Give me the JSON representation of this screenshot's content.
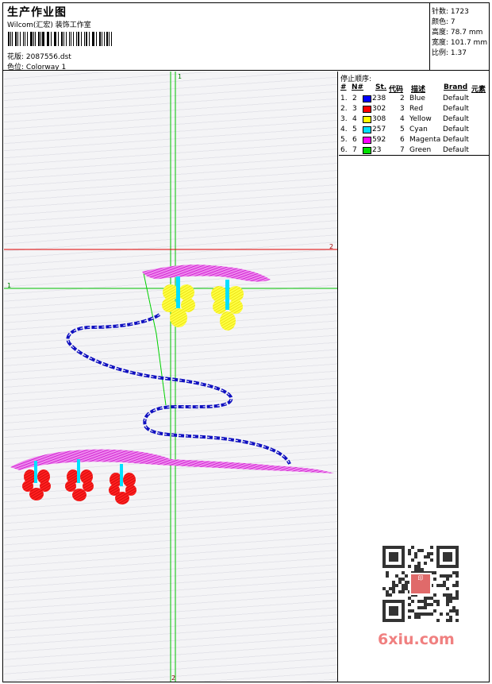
{
  "header": {
    "title": "生产作业图",
    "company": "Wilcom(汇宏) 装饰工作室",
    "design_label": "花版:",
    "design_value": "2087556.dst",
    "colorway_label": "色位:",
    "colorway_value": "Colorway 1"
  },
  "stats": {
    "stitches_label": "针数:",
    "stitches_value": "1723",
    "colors_label": "颜色:",
    "colors_value": "7",
    "height_label": "高度:",
    "height_value": "78.7 mm",
    "width_label": "宽度:",
    "width_value": "101.7 mm",
    "scale_label": "比例:",
    "scale_value": "1.37"
  },
  "canvas": {
    "vguide_top_label": "1",
    "vguide_bottom_label": "2",
    "hguide_left_label": "1",
    "hguide_right_label": "2",
    "guide_green": "#00c000",
    "guide_red": "#e00000"
  },
  "sequence": {
    "title": "停止顺序:",
    "columns": [
      "#",
      "N#",
      "St.",
      "代码",
      "描述",
      "Brand",
      "元素"
    ],
    "rows": [
      {
        "idx": "1.",
        "n": "2",
        "st": "238",
        "code": "2",
        "desc": "Blue",
        "brand": "Default",
        "color": "#0000ff"
      },
      {
        "idx": "2.",
        "n": "3",
        "st": "302",
        "code": "3",
        "desc": "Red",
        "brand": "Default",
        "color": "#ff0000"
      },
      {
        "idx": "3.",
        "n": "4",
        "st": "308",
        "code": "4",
        "desc": "Yellow",
        "brand": "Default",
        "color": "#ffff00"
      },
      {
        "idx": "4.",
        "n": "5",
        "st": "257",
        "code": "5",
        "desc": "Cyan",
        "brand": "Default",
        "color": "#00e0ff"
      },
      {
        "idx": "5.",
        "n": "6",
        "st": "592",
        "code": "6",
        "desc": "Magenta",
        "brand": "Default",
        "color": "#ff00ff"
      },
      {
        "idx": "6.",
        "n": "7",
        "st": "23",
        "code": "7",
        "desc": "Green",
        "brand": "Default",
        "color": "#00e000"
      }
    ]
  },
  "watermark": {
    "site": "6xiu.com",
    "seal": "印"
  }
}
